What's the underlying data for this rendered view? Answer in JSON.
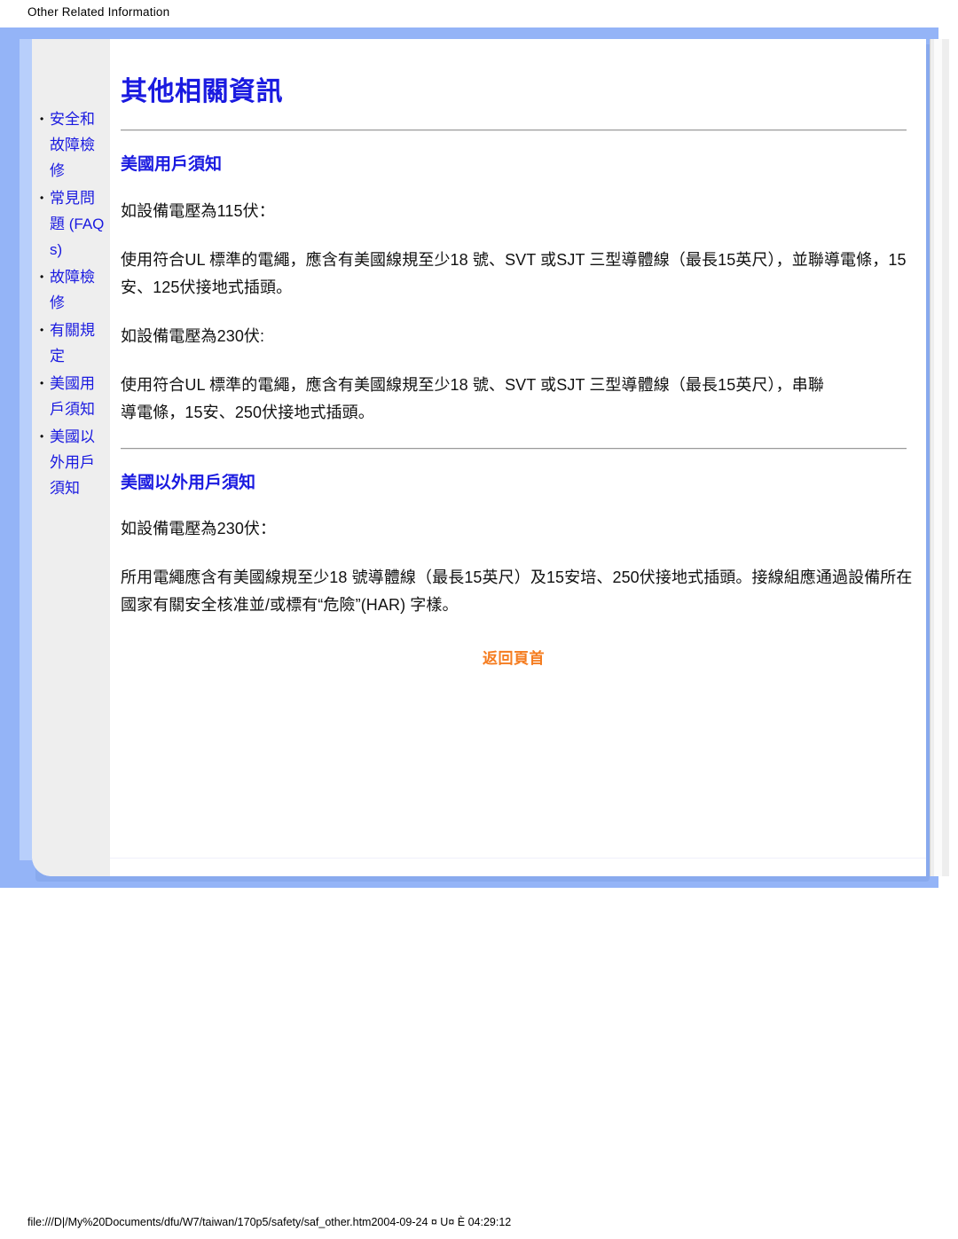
{
  "header": {
    "label": "Other Related Information"
  },
  "sidebar": {
    "items": [
      {
        "label": "安全和故障檢修"
      },
      {
        "label": "常見問題 (FAQs)"
      },
      {
        "label": "故障檢修"
      },
      {
        "label": "有關規定"
      },
      {
        "label": "美國用戶須知"
      },
      {
        "label": "美國以外用戶須知"
      }
    ]
  },
  "main": {
    "title": "其他相關資訊",
    "sections": [
      {
        "heading": "美國用戶須知",
        "paragraphs": [
          "如設備電壓為115伏：",
          "使用符合UL 標準的電繩，應含有美國線規至少18 號、SVT 或SJT 三型導體線（最長15英尺），並聯導電條，15安、125伏接地式插頭。",
          "如設備電壓為230伏:",
          "使用符合UL 標準的電繩，應含有美國線規至少18 號、SVT 或SJT 三型導體線（最長15英尺），串聯導電條，15安、250伏接地式插頭。"
        ]
      },
      {
        "heading": "美國以外用戶須知",
        "paragraphs": [
          "如設備電壓為230伏：",
          "所用電繩應含有美國線規至少18 號導體線（最長15英尺）及15安培、250伏接地式插頭。接線組應通過設備所在國家有關安全核准並/或標有“危險”(HAR) 字樣。"
        ]
      }
    ],
    "back_to_top": "返回頁首"
  },
  "footer": {
    "path_and_time": "file:///D|/My%20Documents/dfu/W7/taiwan/170p5/safety/saf_other.htm2004-09-24 ¤ U¤ È 04:29:12"
  },
  "colors": {
    "link_blue": "#1a1ae0",
    "accent_orange": "#f57c1f",
    "frame_blue": "#94b4f7",
    "sidebar_gray": "#eeeeee"
  }
}
